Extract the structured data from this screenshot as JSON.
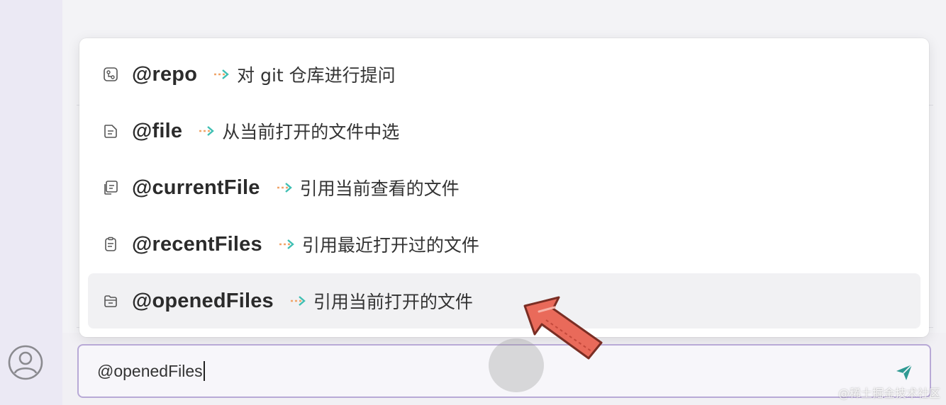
{
  "dropdown": {
    "items": [
      {
        "cmd": "@repo",
        "desc": "对 git 仓库进行提问",
        "icon": "git-repo-icon"
      },
      {
        "cmd": "@file",
        "desc": "从当前打开的文件中选",
        "icon": "file-icon"
      },
      {
        "cmd": "@currentFile",
        "desc": "引用当前查看的文件",
        "icon": "current-file-icon"
      },
      {
        "cmd": "@recentFiles",
        "desc": "引用最近打开过的文件",
        "icon": "recent-files-icon"
      },
      {
        "cmd": "@openedFiles",
        "desc": "引用当前打开的文件",
        "icon": "opened-files-icon",
        "active": true
      }
    ]
  },
  "input": {
    "value": "@openedFiles"
  },
  "colors": {
    "arrow_teal": "#3fbfb3",
    "arrow_orange": "#f0a56a",
    "input_border": "#b8a9d6",
    "send_teal": "#2f9a93",
    "pointer_red": "#e96a5a"
  },
  "watermark": "@稀土掘金技术社区"
}
